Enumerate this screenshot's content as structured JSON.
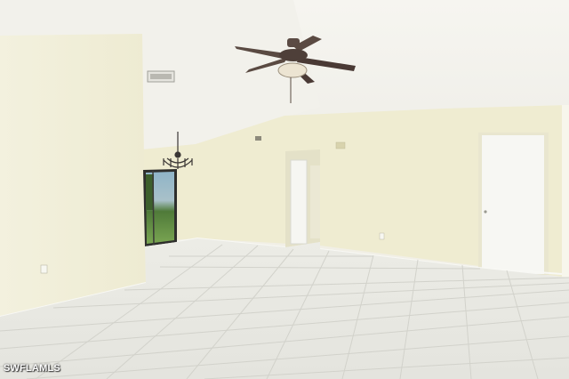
{
  "photo": {
    "subject": "empty-room-interior",
    "watermark": "SWFLAMLS"
  },
  "colors": {
    "ceiling": "#f4f2ec",
    "wall": "#efeccf",
    "floor": "#ebebe5",
    "grout": "#cfcfc8",
    "fan": "#4a3a35",
    "lawn": "#6f9a48"
  }
}
